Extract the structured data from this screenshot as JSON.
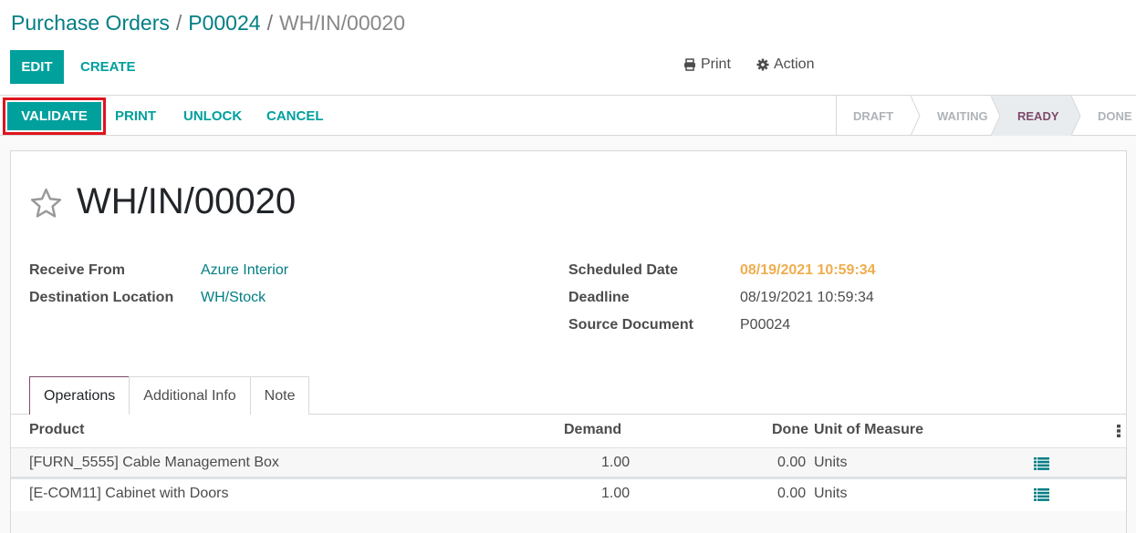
{
  "breadcrumb": {
    "items": [
      "Purchase Orders",
      "P00024"
    ],
    "separator": "/",
    "current": "WH/IN/00020"
  },
  "control_panel": {
    "edit_label": "EDIT",
    "create_label": "CREATE",
    "print_label": "Print",
    "print_icon": "printer-icon",
    "action_label": "Action",
    "action_icon": "gear-icon"
  },
  "statusbar": {
    "buttons": [
      "VALIDATE",
      "PRINT",
      "UNLOCK",
      "CANCEL"
    ],
    "stages": [
      "DRAFT",
      "WAITING",
      "READY",
      "DONE"
    ],
    "active_stage": "READY",
    "highlighted_button": "VALIDATE",
    "highlight_color": "#e0141e"
  },
  "record": {
    "title": "WH/IN/00020",
    "favorite_icon": "star-outline-icon",
    "fields_left": [
      {
        "label": "Receive From",
        "value": "Azure Interior"
      },
      {
        "label": "Destination Location",
        "value": "WH/Stock"
      }
    ],
    "fields_right": [
      {
        "label": "Scheduled Date",
        "value": "08/19/2021 10:59:34"
      },
      {
        "label": "Deadline",
        "value": "08/19/2021 10:59:34"
      },
      {
        "label": "Source Document",
        "value": "P00024"
      }
    ]
  },
  "tabs": [
    "Operations",
    "Additional Info",
    "Note"
  ],
  "active_tab": "Operations",
  "operations_table": {
    "columns": [
      "Product",
      "Demand",
      "Done",
      "Unit of Measure"
    ],
    "rows": [
      {
        "product": "[FURN_5555] Cable Management Box",
        "demand": "1.00",
        "done": "0.00",
        "uom": "Units"
      },
      {
        "product": "[E-COM11] Cabinet with Doors",
        "demand": "1.00",
        "done": "0.00",
        "uom": "Units"
      }
    ]
  },
  "colors": {
    "primary": "#00a09d",
    "link": "#017e84",
    "warning": "#f0ad4e",
    "active_stage": "#7c4a6b"
  }
}
